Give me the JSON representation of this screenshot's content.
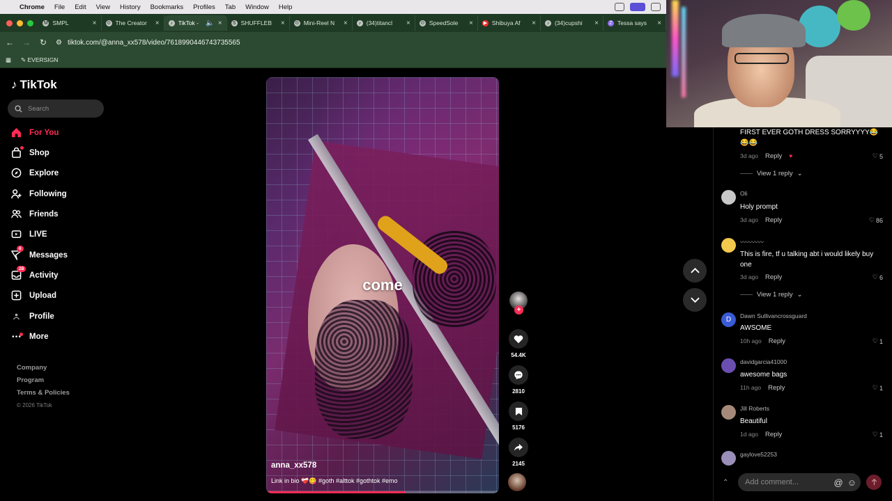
{
  "menubar": {
    "app": "Chrome",
    "items": [
      "File",
      "Edit",
      "View",
      "History",
      "Bookmarks",
      "Profiles",
      "Tab",
      "Window",
      "Help"
    ]
  },
  "tabs": [
    {
      "title": "SMPL",
      "favicon": "M"
    },
    {
      "title": "The Creator",
      "favicon": "⊙"
    },
    {
      "title": "TikTok -",
      "favicon": "♪",
      "active": true
    },
    {
      "title": "SHUFFLEB",
      "favicon": "S"
    },
    {
      "title": "Mini-Reel N",
      "favicon": "⊙"
    },
    {
      "title": "(34)titancl",
      "favicon": "♪"
    },
    {
      "title": "SpeedSole",
      "favicon": "⊙"
    },
    {
      "title": "Shibuya Af",
      "favicon": "▶"
    },
    {
      "title": "(34)cupshi",
      "favicon": "♪"
    },
    {
      "title": "Tessa says",
      "favicon": "Z"
    }
  ],
  "address": {
    "url": "tiktok.com/@anna_xx578/video/7618990446743735565"
  },
  "bookmarks": {
    "items": [
      "EVERSIGN"
    ]
  },
  "sidebar": {
    "logo_text": "TikTok",
    "search_placeholder": "Search",
    "nav": [
      {
        "label": "For You",
        "icon": "home-icon",
        "selected": true
      },
      {
        "label": "Shop",
        "icon": "shop-icon",
        "dot": true
      },
      {
        "label": "Explore",
        "icon": "compass-icon"
      },
      {
        "label": "Following",
        "icon": "user-plus-icon"
      },
      {
        "label": "Friends",
        "icon": "friends-icon"
      },
      {
        "label": "LIVE",
        "icon": "live-icon"
      },
      {
        "label": "Messages",
        "icon": "send-icon",
        "badge": "6"
      },
      {
        "label": "Activity",
        "icon": "inbox-icon",
        "badge": "28"
      },
      {
        "label": "Upload",
        "icon": "plus-square-icon"
      },
      {
        "label": "Profile",
        "icon": "profile-icon"
      },
      {
        "label": "More",
        "icon": "more-icon",
        "dot": true
      }
    ],
    "footer": [
      "Company",
      "Program",
      "Terms & Policies"
    ],
    "copyright": "© 2026 TikTok"
  },
  "video": {
    "caption_overlay": "come",
    "author": "anna_xx578",
    "description": "Link in bio ❤️‍🩹😋 #goth #alttok #gothtok #emo",
    "progress": 0.6
  },
  "actions": {
    "likes": "54.4K",
    "comments": "2810",
    "saves": "5176",
    "shares": "2145"
  },
  "comments": [
    {
      "user": "",
      "text": "FIRST EVER GOTH DRESS SORRYYYY😂 😂😂",
      "time": "3d ago",
      "reply": "Reply",
      "likes": "5",
      "view_replies": "View 1 reply",
      "avatar_color": ""
    },
    {
      "user": "Oli",
      "text": "Holy prompt",
      "time": "3d ago",
      "reply": "Reply",
      "likes": "86",
      "avatar_color": "#c8c8c8"
    },
    {
      "user": "〰〰〰〰",
      "text": "This is fire, tf u talking abt i would likely buy one",
      "time": "3d ago",
      "reply": "Reply",
      "likes": "6",
      "view_replies": "View 1 reply",
      "avatar_color": "#f2c94c"
    },
    {
      "user": "Dawn Sullivancrossguard",
      "text": "AWSOME",
      "time": "10h ago",
      "reply": "Reply",
      "likes": "1",
      "avatar_color": "#3a5bd6",
      "avatar_letter": "D"
    },
    {
      "user": "davidgarcia41000",
      "text": "awesome bags",
      "time": "11h ago",
      "reply": "Reply",
      "likes": "1",
      "avatar_color": "#6a4fb0"
    },
    {
      "user": "Jill Roberts",
      "text": "Beautiful",
      "time": "1d ago",
      "reply": "Reply",
      "likes": "1",
      "avatar_color": "#a58a7a"
    },
    {
      "user": "gaylove52253",
      "text": "",
      "time": "",
      "reply": "",
      "likes": "",
      "avatar_color": "#9a8fb8"
    }
  ],
  "add_comment": {
    "placeholder": "Add comment..."
  },
  "colors": {
    "accent": "#fe2c55",
    "tabbar": "#1f3a24",
    "toolbar": "#2c4a31"
  }
}
